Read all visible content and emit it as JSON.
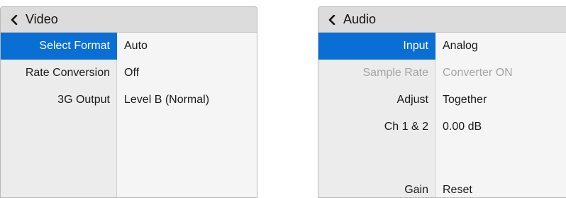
{
  "video": {
    "title": "Video",
    "rows": [
      {
        "label": "Select Format",
        "value": "Auto"
      },
      {
        "label": "Rate Conversion",
        "value": "Off"
      },
      {
        "label": "3G Output",
        "value": "Level B (Normal)"
      }
    ]
  },
  "audio": {
    "title": "Audio",
    "rows": [
      {
        "label": "Input",
        "value": "Analog"
      },
      {
        "label": "Sample Rate",
        "value": "Converter ON"
      },
      {
        "label": "Adjust",
        "value": "Together"
      },
      {
        "label": "Ch 1 & 2",
        "value": "0.00 dB"
      },
      {
        "label": "Gain",
        "value": "Reset"
      }
    ]
  },
  "colors": {
    "selected": "#0a6fd4",
    "header": "#dcdcdc",
    "disabled_text": "#a4a4a4"
  },
  "icons": {
    "back": "chevron-left-icon"
  }
}
